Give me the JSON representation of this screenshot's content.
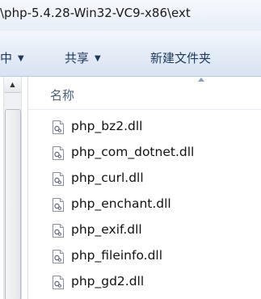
{
  "address": {
    "path": "\\php-5.4.28-Win32-VC9-x86\\ext"
  },
  "toolbar": {
    "include_label": "中",
    "share_label": "共享",
    "new_folder_label": "新建文件夹"
  },
  "file_list": {
    "column_name": "名称",
    "files": [
      {
        "name": "php_bz2.dll",
        "icon": "dll-file-icon"
      },
      {
        "name": "php_com_dotnet.dll",
        "icon": "dll-file-icon"
      },
      {
        "name": "php_curl.dll",
        "icon": "dll-file-icon"
      },
      {
        "name": "php_enchant.dll",
        "icon": "dll-file-icon"
      },
      {
        "name": "php_exif.dll",
        "icon": "dll-file-icon"
      },
      {
        "name": "php_fileinfo.dll",
        "icon": "dll-file-icon"
      },
      {
        "name": "php_gd2.dll",
        "icon": "dll-file-icon"
      }
    ]
  },
  "colors": {
    "toolbar_text": "#1e395b",
    "header_text": "#4c607a"
  }
}
